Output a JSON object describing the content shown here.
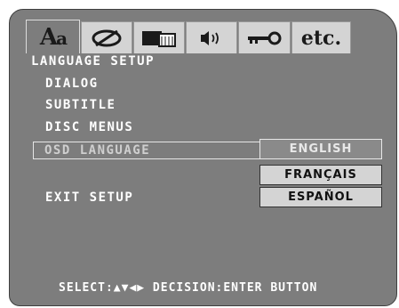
{
  "tabs": [
    {
      "icon": "language-icon",
      "label": "Aa",
      "active": true
    },
    {
      "icon": "audio-disc-icon"
    },
    {
      "icon": "video-screen-icon"
    },
    {
      "icon": "speaker-icon"
    },
    {
      "icon": "key-icon"
    },
    {
      "icon": "etc-icon",
      "label": "etc."
    }
  ],
  "page_title": "LANGUAGE SETUP",
  "menu": {
    "dialog": "DIALOG",
    "subtitle": "SUBTITLE",
    "disc_menus": "DISC MENUS",
    "osd_language": "OSD LANGUAGE",
    "exit_setup": "EXIT SETUP"
  },
  "osd_options": {
    "english": "ENGLISH",
    "francais": "FRANÇAIS",
    "espanol": "ESPAÑOL",
    "selected": "ENGLISH"
  },
  "footer": "SELECT:▲▼◀▶ DECISION:ENTER BUTTON",
  "colors": {
    "screen_bg": "#7d7d7d",
    "tab_inactive_bg": "#d4d4d4",
    "text": "#ffffff"
  }
}
